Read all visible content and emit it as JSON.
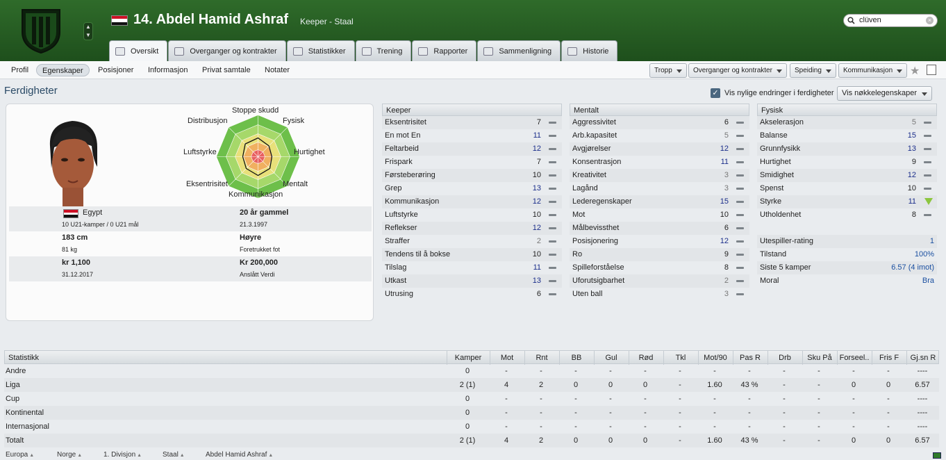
{
  "header": {
    "name": "14. Abdel Hamid Ashraf",
    "role": "Keeper - Staal",
    "search_value": "clüven"
  },
  "tabs": [
    {
      "label": "Oversikt",
      "icon": "profile-card-icon"
    },
    {
      "label": "Overganger og kontrakter",
      "icon": "contract-icon"
    },
    {
      "label": "Statistikker",
      "icon": "stats-icon"
    },
    {
      "label": "Trening",
      "icon": "ball-icon"
    },
    {
      "label": "Rapporter",
      "icon": "report-icon"
    },
    {
      "label": "Sammenligning",
      "icon": "compare-icon"
    },
    {
      "label": "Historie",
      "icon": "history-icon"
    }
  ],
  "subnav": {
    "items": [
      "Profil",
      "Egenskaper",
      "Posisjoner",
      "Informasjon",
      "Privat samtale",
      "Notater"
    ],
    "dropdowns": [
      "Tropp",
      "Overganger og kontrakter",
      "Speiding",
      "Kommunikasjon"
    ]
  },
  "section": {
    "title": "Ferdigheter",
    "checkbox_label": "Vis nylige endringer i ferdigheter",
    "key_button": "Vis nøkkelegenskaper"
  },
  "radar_labels": [
    "Stoppe skudd",
    "Fysisk",
    "Hurtighet",
    "Mentalt",
    "Kommunikasjon",
    "Eksentrisitet",
    "Luftstyrke",
    "Distribusjon"
  ],
  "info": {
    "nation": "Egypt",
    "caps": "10 U21-kamper / 0 U21 mål",
    "age": "20 år gammel",
    "dob": "21.3.1997",
    "height": "183 cm",
    "weight": "81 kg",
    "foot": "Høyre",
    "foot_label": "Foretrukket fot",
    "wage": "kr 1,100",
    "contract": "31.12.2017",
    "value": "Kr 200,000",
    "value_label": "Anslått Verdi"
  },
  "keeper": {
    "title": "Keeper",
    "attrs": [
      {
        "n": "Eksentrisitet",
        "v": "7",
        "c": "n"
      },
      {
        "n": "En mot En",
        "v": "11",
        "c": "b"
      },
      {
        "n": "Feltarbeid",
        "v": "12",
        "c": "b"
      },
      {
        "n": "Frispark",
        "v": "7",
        "c": "n"
      },
      {
        "n": "Førsteberøring",
        "v": "10",
        "c": "n"
      },
      {
        "n": "Grep",
        "v": "13",
        "c": "b"
      },
      {
        "n": "Kommunikasjon",
        "v": "12",
        "c": "b"
      },
      {
        "n": "Luftstyrke",
        "v": "10",
        "c": "n"
      },
      {
        "n": "Reflekser",
        "v": "12",
        "c": "b"
      },
      {
        "n": "Straffer",
        "v": "2",
        "c": "g"
      },
      {
        "n": "Tendens til å bokse",
        "v": "10",
        "c": "n"
      },
      {
        "n": "Tilslag",
        "v": "11",
        "c": "b"
      },
      {
        "n": "Utkast",
        "v": "13",
        "c": "b"
      },
      {
        "n": "Utrusing",
        "v": "6",
        "c": "n"
      }
    ]
  },
  "mental": {
    "title": "Mentalt",
    "attrs": [
      {
        "n": "Aggressivitet",
        "v": "6",
        "c": "n"
      },
      {
        "n": "Arb.kapasitet",
        "v": "5",
        "c": "g"
      },
      {
        "n": "Avgjørelser",
        "v": "12",
        "c": "b"
      },
      {
        "n": "Konsentrasjon",
        "v": "11",
        "c": "b"
      },
      {
        "n": "Kreativitet",
        "v": "3",
        "c": "g"
      },
      {
        "n": "Lagånd",
        "v": "3",
        "c": "g"
      },
      {
        "n": "Lederegenskaper",
        "v": "15",
        "c": "b"
      },
      {
        "n": "Mot",
        "v": "10",
        "c": "n"
      },
      {
        "n": "Målbevissthet",
        "v": "6",
        "c": "n"
      },
      {
        "n": "Posisjonering",
        "v": "12",
        "c": "b"
      },
      {
        "n": "Ro",
        "v": "9",
        "c": "n"
      },
      {
        "n": "Spilleforståelse",
        "v": "8",
        "c": "n"
      },
      {
        "n": "Uforutsigbarhet",
        "v": "2",
        "c": "g"
      },
      {
        "n": "Uten ball",
        "v": "3",
        "c": "g"
      }
    ]
  },
  "physical": {
    "title": "Fysisk",
    "attrs": [
      {
        "n": "Akselerasjon",
        "v": "5",
        "c": "g"
      },
      {
        "n": "Balanse",
        "v": "15",
        "c": "b"
      },
      {
        "n": "Grunnfysikk",
        "v": "13",
        "c": "b"
      },
      {
        "n": "Hurtighet",
        "v": "9",
        "c": "n"
      },
      {
        "n": "Smidighet",
        "v": "12",
        "c": "b"
      },
      {
        "n": "Spenst",
        "v": "10",
        "c": "n"
      },
      {
        "n": "Styrke",
        "v": "11",
        "c": "b"
      },
      {
        "n": "Utholdenhet",
        "v": "8",
        "c": "n"
      }
    ],
    "extra": [
      {
        "n": "Utespiller-rating",
        "v": "1"
      },
      {
        "n": "Tilstand",
        "v": "100%"
      },
      {
        "n": "Siste 5 kamper",
        "v": "6.57 (4 imot)"
      },
      {
        "n": "Moral",
        "v": "Bra"
      }
    ]
  },
  "stats": {
    "headers": [
      "Statistikk",
      "Kamper",
      "Mot",
      "Rnt",
      "BB",
      "Gul",
      "Rød",
      "Tkl",
      "Mot/90",
      "Pas R",
      "Drb",
      "Sku På",
      "Forseel..",
      "Fris F",
      "Gj.sn R"
    ],
    "rows": [
      [
        "Andre",
        "0",
        "-",
        "-",
        "-",
        "-",
        "-",
        "-",
        "-",
        "-",
        "-",
        "-",
        "-",
        "-",
        "----"
      ],
      [
        "Liga",
        "2 (1)",
        "4",
        "2",
        "0",
        "0",
        "0",
        "-",
        "1.60",
        "43 %",
        "-",
        "-",
        "0",
        "0",
        "6.57"
      ],
      [
        "Cup",
        "0",
        "-",
        "-",
        "-",
        "-",
        "-",
        "-",
        "-",
        "-",
        "-",
        "-",
        "-",
        "-",
        "----"
      ],
      [
        "Kontinental",
        "0",
        "-",
        "-",
        "-",
        "-",
        "-",
        "-",
        "-",
        "-",
        "-",
        "-",
        "-",
        "-",
        "----"
      ],
      [
        "Internasjonal",
        "0",
        "-",
        "-",
        "-",
        "-",
        "-",
        "-",
        "-",
        "-",
        "-",
        "-",
        "-",
        "-",
        "----"
      ],
      [
        "Totalt",
        "2 (1)",
        "4",
        "2",
        "0",
        "0",
        "0",
        "-",
        "1.60",
        "43 %",
        "-",
        "-",
        "0",
        "0",
        "6.57"
      ]
    ]
  },
  "breadcrumb": [
    "Europa",
    "Norge",
    "1. Divisjon",
    "Staal",
    "Abdel Hamid Ashraf"
  ],
  "colors": {
    "header_green": "#2f6b2a",
    "value_blue": "#1a2d8a",
    "low_grey": "#777"
  }
}
